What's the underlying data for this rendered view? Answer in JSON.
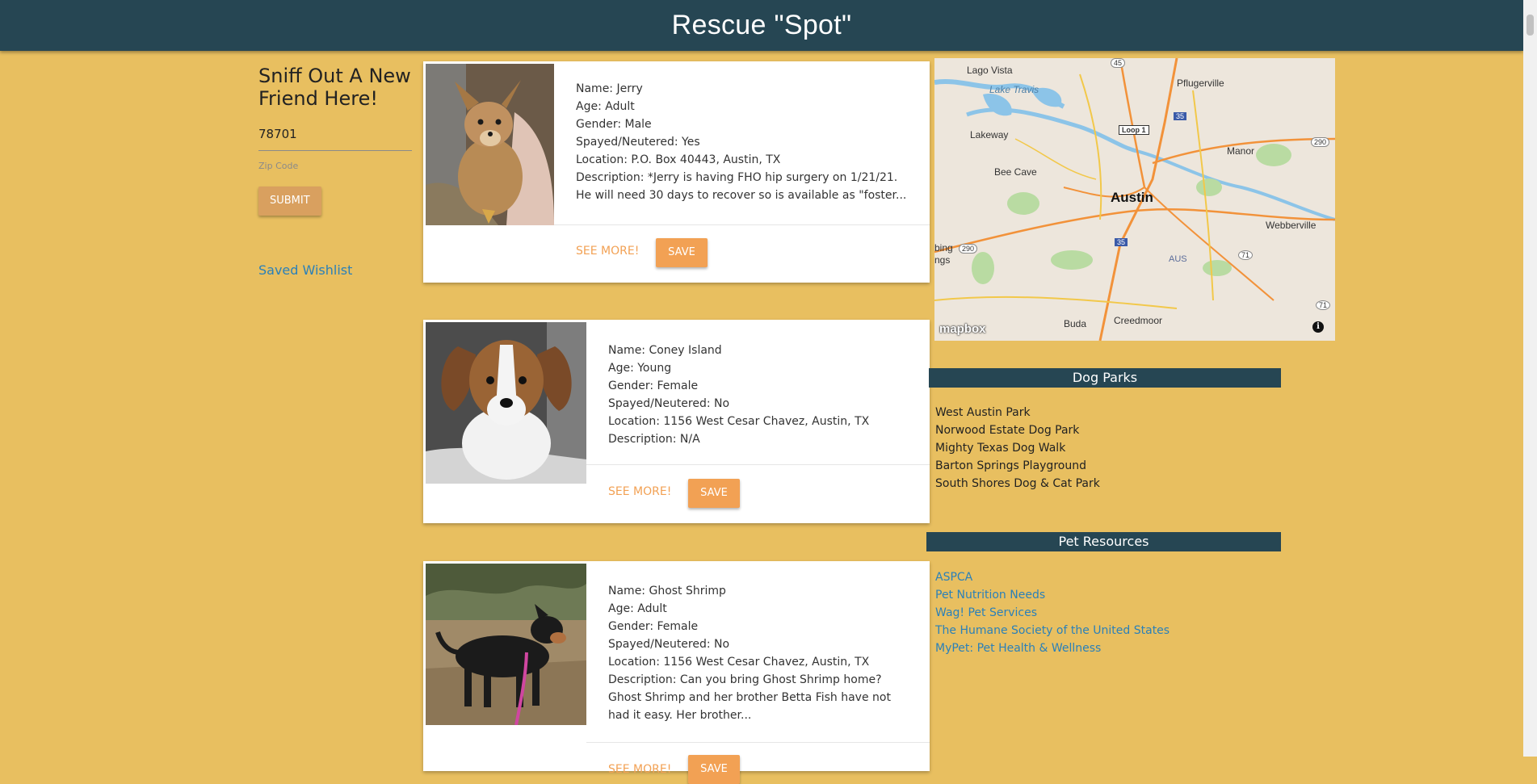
{
  "header": {
    "title": "Rescue \"Spot\""
  },
  "sidebar": {
    "heading": "Sniff Out A New Friend Here!",
    "zip_value": "78701",
    "zip_helper": "Zip Code",
    "submit_label": "SUBMIT",
    "wishlist_label": "Saved Wishlist"
  },
  "cards": [
    {
      "name": "Name: Jerry",
      "age": "Age: Adult",
      "gender": "Gender: Male",
      "spayed": "Spayed/Neutered: Yes",
      "location": "Location: P.O. Box 40443, Austin, TX",
      "description": "Description: *Jerry is having FHO hip surgery on 1/21/21. He will need 30 days to recover so is available as \"foster...",
      "see_more": "SEE MORE!",
      "save": "SAVE"
    },
    {
      "name": "Name: Coney Island",
      "age": "Age: Young",
      "gender": "Gender: Female",
      "spayed": "Spayed/Neutered: No",
      "location": "Location: 1156 West Cesar Chavez, Austin, TX",
      "description": "Description: N/A",
      "see_more": "SEE MORE!",
      "save": "SAVE"
    },
    {
      "name": "Name: Ghost Shrimp",
      "age": "Age: Adult",
      "gender": "Gender: Female",
      "spayed": "Spayed/Neutered: No",
      "location": "Location: 1156 West Cesar Chavez, Austin, TX",
      "description": "Description: Can you bring Ghost Shrimp home? Ghost Shrimp and her brother Betta Fish have not had it easy. Her brother...",
      "see_more": "SEE MORE!",
      "save": "SAVE"
    }
  ],
  "map": {
    "city": "Austin",
    "towns": [
      "Lago Vista",
      "Pflugerville",
      "Lake Travis",
      "Lakeway",
      "Manor",
      "Bee Cave",
      "Webberville",
      "Buda",
      "Creedmoor",
      "AUS",
      "bing",
      "ngs"
    ],
    "shields": [
      "45",
      "35",
      "Loop 1",
      "290",
      "35",
      "290",
      "71",
      "71"
    ],
    "logo": "mapbox",
    "info_glyph": "i"
  },
  "dog_parks": {
    "title": "Dog Parks",
    "items": [
      "West Austin Park",
      "Norwood Estate Dog Park",
      "Mighty Texas Dog Walk",
      "Barton Springs Playground",
      "South Shores Dog & Cat Park"
    ]
  },
  "pet_resources": {
    "title": "Pet Resources",
    "items": [
      "ASPCA",
      "Pet Nutrition Needs",
      "Wag! Pet Services",
      "The Humane Society of the United States",
      "MyPet: Pet Health & Wellness"
    ]
  }
}
